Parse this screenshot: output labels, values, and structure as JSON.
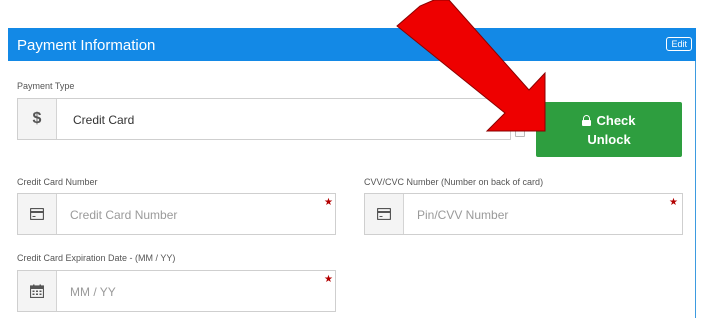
{
  "header": {
    "title": "Payment Information",
    "edit_label": "Edit"
  },
  "payment_type": {
    "label": "Payment Type",
    "icon": "dollar-icon",
    "icon_glyph": "$",
    "value": "Credit Card"
  },
  "check_button": {
    "line1": "Check",
    "line2": "Unlock",
    "icon": "lock-icon"
  },
  "card_number": {
    "label": "Credit Card Number",
    "placeholder": "Credit Card Number",
    "icon": "credit-card-icon",
    "required_mark": "★"
  },
  "cvv": {
    "label": "CVV/CVC Number (Number on back of card)",
    "placeholder": "Pin/CVV Number",
    "icon": "credit-card-icon",
    "required_mark": "★"
  },
  "expiration": {
    "label": "Credit Card Expiration Date - (MM / YY)",
    "placeholder": "MM / YY",
    "icon": "calendar-icon",
    "required_mark": "★"
  },
  "colors": {
    "header": "#1389e6",
    "button": "#2e9e3f",
    "arrow": "#ee0000",
    "required": "#b30000"
  },
  "overlay": {
    "arrow": "red-arrow-pointing-to-check-button"
  }
}
